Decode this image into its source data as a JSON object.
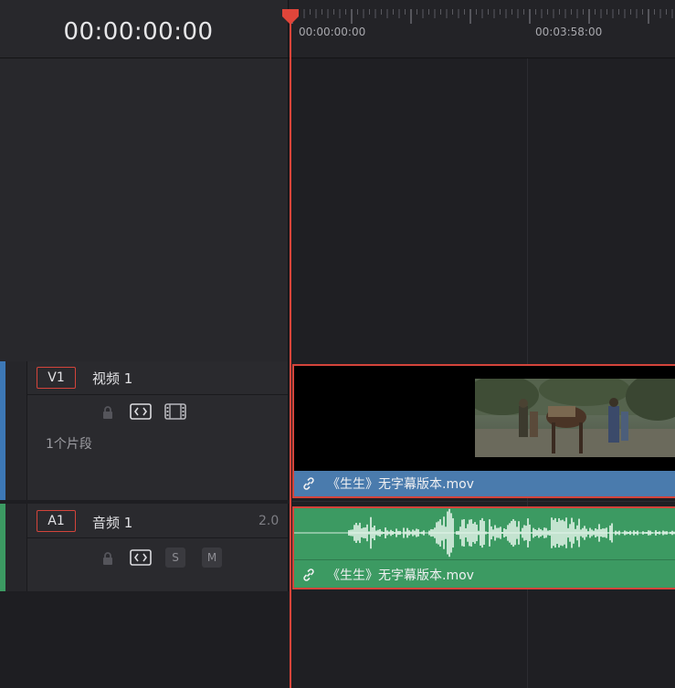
{
  "header": {
    "timecode": "00:00:00:00"
  },
  "ruler": {
    "labels": [
      "00:00:00:00",
      "00:03:58:00"
    ]
  },
  "video_track": {
    "id": "V1",
    "name": "视频 1",
    "clip_count": "1个片段",
    "color": "#3d78b6",
    "icons": [
      "lock-icon",
      "auto-select-icon",
      "film-strip-icon"
    ],
    "clip": {
      "label": "《生生》无字幕版本.mov",
      "color": "#4a7bad"
    }
  },
  "audio_track": {
    "id": "A1",
    "name": "音频 1",
    "channels": "2.0",
    "color": "#3c9a62",
    "icons": [
      "lock-icon",
      "auto-select-icon"
    ],
    "solo_label": "S",
    "mute_label": "M",
    "clip": {
      "label": "《生生》无字幕版本.mov",
      "color": "#3c9a62"
    }
  },
  "colors": {
    "playhead": "#e0453a",
    "selection": "#d4443b"
  }
}
